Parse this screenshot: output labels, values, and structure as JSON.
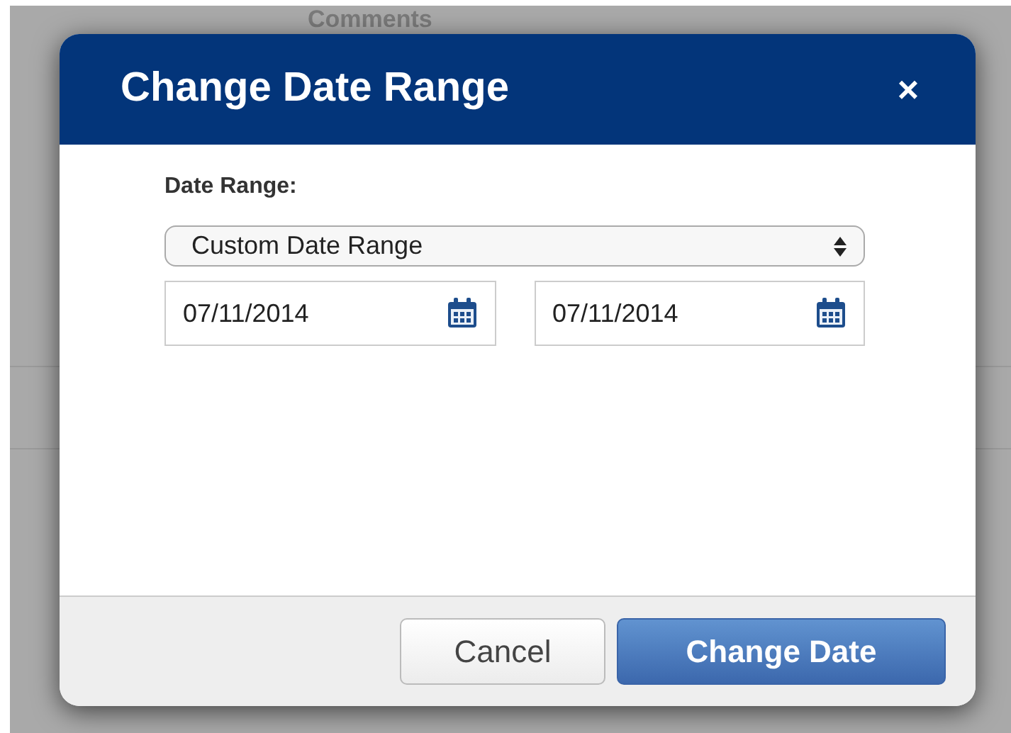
{
  "background": {
    "heading": "Comments"
  },
  "dialog": {
    "title": "Change Date Range",
    "close": "×",
    "date_range": {
      "label": "Date Range:",
      "value": "Custom Date Range",
      "start": "07/11/2014",
      "end": "07/11/2014"
    },
    "buttons": [
      {
        "label": "Cancel",
        "kind": "secondary"
      },
      {
        "label": "Change Date",
        "kind": "primary"
      }
    ]
  }
}
